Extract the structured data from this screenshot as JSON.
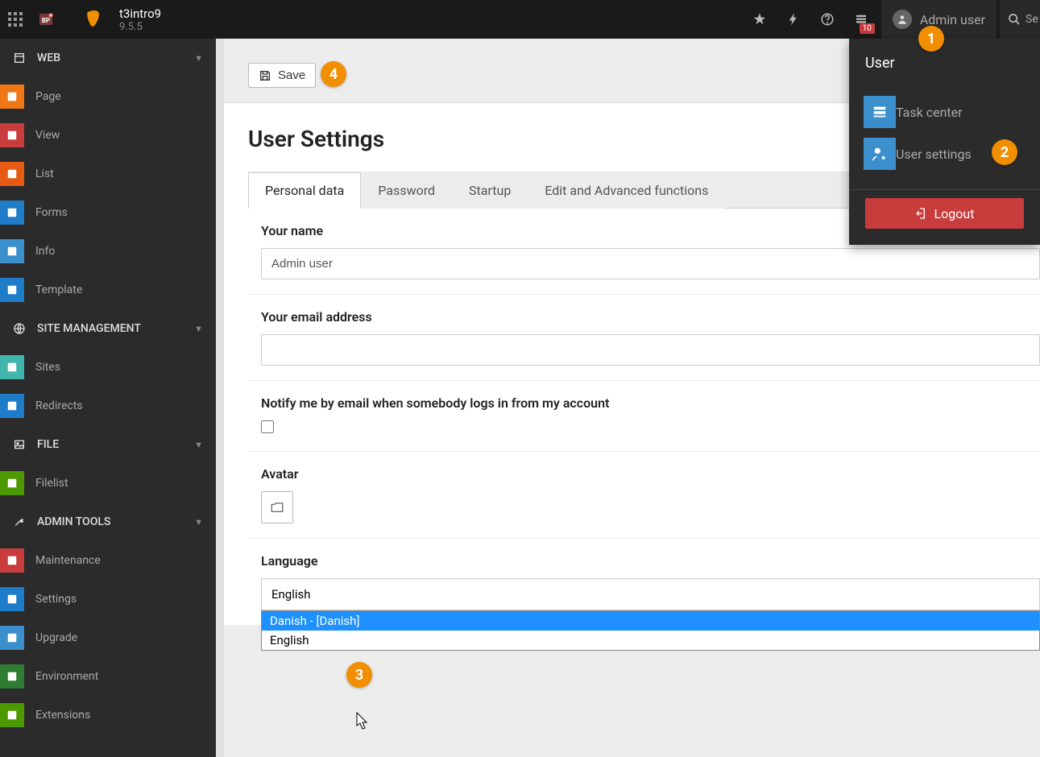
{
  "topbar": {
    "site_name": "t3intro9",
    "version": "9.5.5",
    "notification_count": "10",
    "user_label": "Admin user",
    "search_label": "Se"
  },
  "user_dropdown": {
    "title": "User",
    "items": [
      {
        "label": "Task center"
      },
      {
        "label": "User settings"
      }
    ],
    "logout_label": "Logout"
  },
  "sidebar": {
    "sections": [
      {
        "label": "WEB",
        "items": [
          {
            "label": "Page",
            "color": "si-orange"
          },
          {
            "label": "View",
            "color": "si-red"
          },
          {
            "label": "List",
            "color": "si-orange2"
          },
          {
            "label": "Forms",
            "color": "si-blue"
          },
          {
            "label": "Info",
            "color": "si-lightblue"
          },
          {
            "label": "Template",
            "color": "si-blue"
          }
        ]
      },
      {
        "label": "SITE MANAGEMENT",
        "items": [
          {
            "label": "Sites",
            "color": "si-teal"
          },
          {
            "label": "Redirects",
            "color": "si-bblue"
          }
        ]
      },
      {
        "label": "FILE",
        "items": [
          {
            "label": "Filelist",
            "color": "si-green"
          }
        ]
      },
      {
        "label": "ADMIN TOOLS",
        "items": [
          {
            "label": "Maintenance",
            "color": "si-red2"
          },
          {
            "label": "Settings",
            "color": "si-dblue"
          },
          {
            "label": "Upgrade",
            "color": "si-lightblue"
          },
          {
            "label": "Environment",
            "color": "si-green2"
          },
          {
            "label": "Extensions",
            "color": "si-green"
          }
        ]
      }
    ]
  },
  "content": {
    "save_label": "Save",
    "page_title": "User Settings",
    "tabs": [
      {
        "label": "Personal data",
        "active": true
      },
      {
        "label": "Password"
      },
      {
        "label": "Startup"
      },
      {
        "label": "Edit and Advanced functions"
      }
    ],
    "fields": {
      "name_label": "Your name",
      "name_value": "Admin user",
      "email_label": "Your email address",
      "email_value": "",
      "notify_label": "Notify me by email when somebody logs in from my account",
      "avatar_label": "Avatar",
      "language_label": "Language",
      "language_value": "English",
      "language_options": [
        {
          "label": "Danish - [Danish]",
          "highlighted": true
        },
        {
          "label": "English"
        }
      ]
    }
  },
  "markers": {
    "m1": "1",
    "m2": "2",
    "m3": "3",
    "m4": "4"
  }
}
